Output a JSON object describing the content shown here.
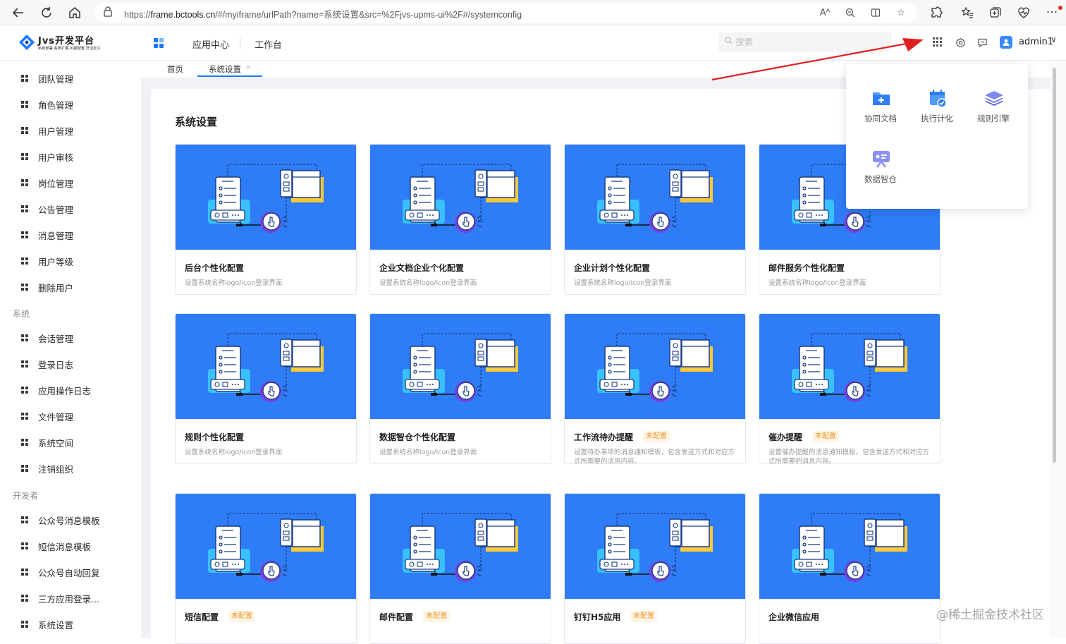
{
  "browser": {
    "url_prefix": "https://",
    "url_host": "frame.bctools.cn",
    "url_path": "/#/myiframe/urlPath?name=系统设置&src=%2Fjvs-upms-ui%2F#/systemconfig",
    "icons": [
      "back-arrow-icon",
      "refresh-icon",
      "home-icon",
      "lock-icon",
      "read-aloud-icon",
      "zoom-icon",
      "split-screen-icon",
      "favorite-star-icon",
      "extensions-icon",
      "favorites-icon",
      "collections-icon",
      "performance-icon"
    ]
  },
  "header": {
    "logo_title": "Jvs开发平台",
    "logo_subtitle": "私有部署,系统扩展,可视配置,灵活定义",
    "nav": [
      "应用中心",
      "工作台"
    ],
    "search_placeholder": "搜索",
    "username": "admin1",
    "caret": "∨"
  },
  "sidebar": {
    "items_a": [
      "团队管理",
      "角色管理",
      "用户管理",
      "用户审核",
      "岗位管理",
      "公告管理",
      "消息管理",
      "用户等级",
      "删除用户"
    ],
    "group_system": "系统",
    "items_b": [
      "会话管理",
      "登录日志",
      "应用操作日志",
      "文件管理",
      "系统空间",
      "注销组织"
    ],
    "group_dev": "开发者",
    "items_c": [
      "公众号消息模板",
      "短信消息模板",
      "公众号自动回复",
      "三方应用登录...",
      "系统设置"
    ]
  },
  "tabs": {
    "home": "首页",
    "active": "系统设置",
    "close": "×"
  },
  "main": {
    "title": "系统设置",
    "cards": [
      {
        "title": "后台个性化配置",
        "desc": "设置系统名称logo/icon登录界面",
        "badge": ""
      },
      {
        "title": "企业文档企业个化配置",
        "desc": "设置系统名称logo/icon登录界面",
        "badge": ""
      },
      {
        "title": "企业计划个性化配置",
        "desc": "设置系统名称logo/icon登录界面",
        "badge": ""
      },
      {
        "title": "邮件服务个性化配置",
        "desc": "设置系统名称logo/icon登录界面",
        "badge": ""
      },
      {
        "title": "规则个性化配置",
        "desc": "设置系统名称logo/icon登录界面",
        "badge": ""
      },
      {
        "title": "数据智仓个性化配置",
        "desc": "设置系统名称logo/icon登录界面",
        "badge": ""
      },
      {
        "title": "工作流待办提醒",
        "desc": "设置待办事项的消息通知模板，包含发送方式和对应方式所需要的消息内容。",
        "badge": "未配置"
      },
      {
        "title": "催办提醒",
        "desc": "设置催办提醒的消息通知模板，包含发送方式和对应方式所需要的消息内容。",
        "badge": "未配置"
      },
      {
        "title": "短信配置",
        "desc": "",
        "badge": "未配置"
      },
      {
        "title": "邮件配置",
        "desc": "",
        "badge": "未配置"
      },
      {
        "title": "钉钉H5应用",
        "desc": "",
        "badge": "未配置"
      },
      {
        "title": "企业微信应用",
        "desc": "",
        "badge": ""
      }
    ]
  },
  "app_panel": {
    "apps": [
      {
        "label": "协同文档",
        "icon": "folder-plus-icon"
      },
      {
        "label": "执行计化",
        "icon": "calendar-check-icon"
      },
      {
        "label": "规则引擎",
        "icon": "layers-icon"
      },
      {
        "label": "数据智仓",
        "icon": "data-screen-icon"
      }
    ]
  },
  "watermark": "@稀土掘金技术社区",
  "colors": {
    "accent": "#1677ff",
    "card_hero": "#2e7cf6",
    "badge": "#f0962c",
    "arrow": "#e02020"
  }
}
